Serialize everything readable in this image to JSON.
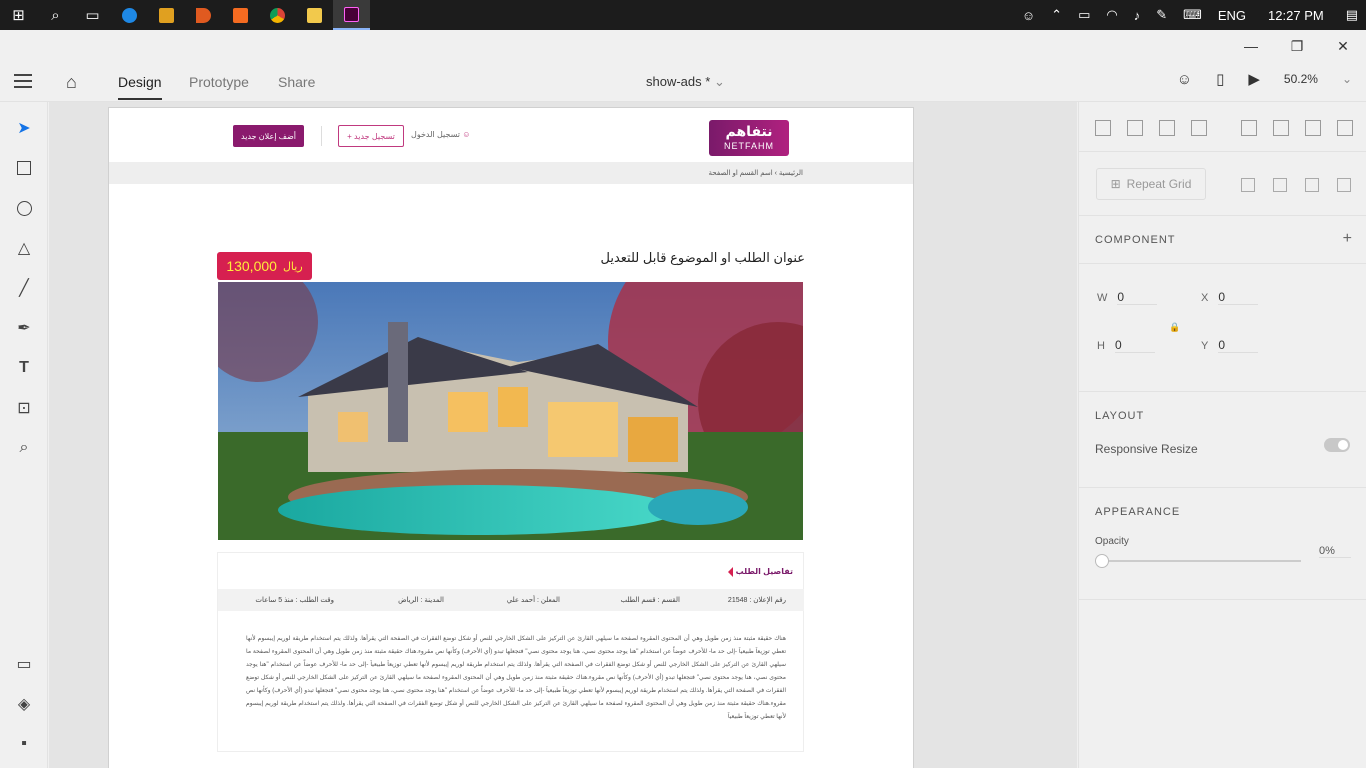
{
  "taskbar": {
    "right_items": [
      "ENG",
      "12:27 PM"
    ]
  },
  "window": {
    "minimize": "—",
    "restore": "❐",
    "close": "✕"
  },
  "appbar": {
    "tabs": [
      "Design",
      "Prototype",
      "Share"
    ],
    "active_tab": "Design",
    "document_name": "show-ads *",
    "zoom": "50.2%"
  },
  "artboard": {
    "logo_ar": "نتفاهم",
    "logo_en": "NETFAHM",
    "add_button": "أضف إعلان جديد",
    "register_button": "+ تسجيل جديد",
    "login_link": "تسجيل الدخول",
    "breadcrumb": "الرئيسية › اسم القسم او الصفحة",
    "ad_title": "عنوان الطلب او الموضوع قابل للتعديل",
    "price_value": "130,000",
    "price_currency": "ريال",
    "details_title": "تفاصيل الطلب",
    "meta": {
      "ad_number": "رقم الإعلان : 21548",
      "category": "القسم : قسم الطلب",
      "advertiser": "المعلن : أحمد علي",
      "city": "المدينة : الرياض",
      "time": "وقت الطلب : منذ 5 ساعات"
    },
    "body_text": "هناك حقيقة مثبتة منذ زمن طويل وهي أن المحتوى المقروء لصفحة ما سيلهي القارئ عن التركيز على الشكل الخارجي للنص أو شكل توضع الفقرات في الصفحة التي يقرأها. ولذلك يتم استخدام طريقة لوريم إيبسوم لأنها تعطي توزيعاَ طبيعياَ -إلى حد ما- للأحرف عوضاً عن استخدام \"هنا يوجد محتوى نصي، هنا يوجد محتوى نصي\" فتجعلها تبدو (أي الأحرف) وكأنها نص مقروء.هناك حقيقة مثبتة منذ زمن طويل وهي أن المحتوى المقروء لصفحة ما سيلهي القارئ عن التركيز على الشكل الخارجي للنص أو شكل توضع الفقرات في الصفحة التي يقرأها. ولذلك يتم استخدام طريقة لوريم إيبسوم لأنها تعطي توزيعاَ طبيعياَ -إلى حد ما- للأحرف عوضاً عن استخدام \"هنا يوجد محتوى نصي، هنا يوجد محتوى نصي\" فتجعلها تبدو (أي الأحرف) وكأنها نص مقروء.هناك حقيقة مثبتة منذ زمن طويل وهي أن المحتوى المقروء لصفحة ما سيلهي القارئ عن التركيز على الشكل الخارجي للنص أو شكل توضع الفقرات في الصفحة التي يقرأها. ولذلك يتم استخدام طريقة لوريم إيبسوم لأنها تعطي توزيعاَ طبيعياَ -إلى حد ما- للأحرف عوضاً عن استخدام \"هنا يوجد محتوى نصي، هنا يوجد محتوى نصي\" فتجعلها تبدو (أي الأحرف) وكأنها نص مقروء.هناك حقيقة مثبتة منذ زمن طويل وهي أن المحتوى المقروء لصفحة ما سيلهي القارئ عن التركيز على الشكل الخارجي للنص أو شكل توضع الفقرات في الصفحة التي يقرأها. ولذلك يتم استخدام طريقة لوريم إيبسوم لأنها تعطي توزيعاَ طبيعياَ"
  },
  "rightpanel": {
    "repeat_grid": "Repeat Grid",
    "component_label": "COMPONENT",
    "w_label": "W",
    "w_value": "0",
    "x_label": "X",
    "x_value": "0",
    "h_label": "H",
    "h_value": "0",
    "y_label": "Y",
    "y_value": "0",
    "layout_label": "LAYOUT",
    "responsive_resize": "Responsive Resize",
    "appearance_label": "APPEARANCE",
    "opacity_label": "Opacity",
    "opacity_value": "0%"
  },
  "colors": {
    "brand": "#8a1a6d",
    "price_bg": "#d62050",
    "price_text": "#ffeb3b"
  }
}
